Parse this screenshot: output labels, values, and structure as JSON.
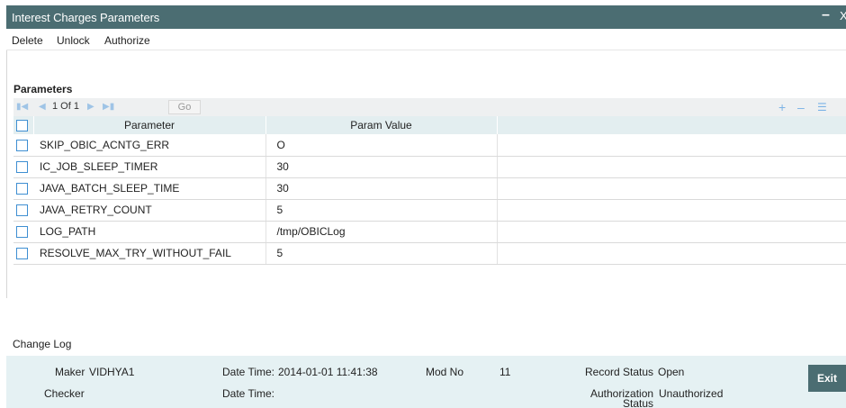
{
  "window": {
    "title": "Interest Charges Parameters",
    "minimize_glyph": "–",
    "close_glyph": "X"
  },
  "menu": {
    "items": [
      "Delete",
      "Unlock",
      "Authorize"
    ]
  },
  "section": {
    "title": "Parameters"
  },
  "pagination": {
    "page_text": "1 Of 1",
    "go_label": "Go"
  },
  "toolbar_icons": [
    "add-icon",
    "remove-icon",
    "list-view-icon"
  ],
  "grid": {
    "columns": [
      "Parameter",
      "Param Value",
      ""
    ],
    "rows": [
      {
        "parameter": "SKIP_OBIC_ACNTG_ERR",
        "value": "O"
      },
      {
        "parameter": "IC_JOB_SLEEP_TIMER",
        "value": "30"
      },
      {
        "parameter": "JAVA_BATCH_SLEEP_TIME",
        "value": "30"
      },
      {
        "parameter": "JAVA_RETRY_COUNT",
        "value": "5"
      },
      {
        "parameter": "LOG_PATH",
        "value": "/tmp/OBICLog"
      },
      {
        "parameter": "RESOLVE_MAX_TRY_WITHOUT_FAIL",
        "value": "5"
      }
    ]
  },
  "changelog": {
    "title": "Change Log",
    "maker_label": "Maker",
    "maker_value": "VIDHYA1",
    "checker_label": "Checker",
    "checker_value": "",
    "datetime_label": "Date Time:",
    "maker_datetime": "2014-01-01 11:41:38",
    "checker_datetime": "",
    "modno_label": "Mod No",
    "modno_value": "11",
    "record_status_label": "Record Status",
    "record_status_value": "Open",
    "auth_status_label_1": "Authorization",
    "auth_status_label_2": "Status",
    "auth_status_value": "Unauthorized",
    "exit_label": "Exit"
  },
  "colors": {
    "titlebar": "#4b6d72",
    "footer_bg": "#e5f1f3",
    "grid_header_bg": "#e3eef0",
    "checkbox_border": "#3f8fd2"
  }
}
